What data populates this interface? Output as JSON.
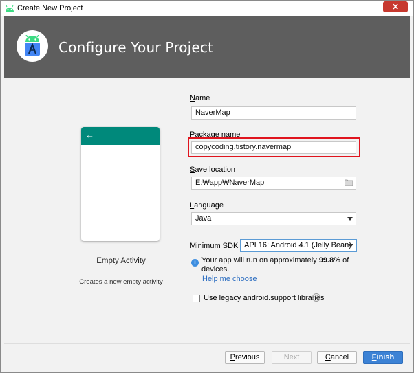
{
  "window": {
    "title": "Create New Project",
    "close_glyph": "✕"
  },
  "header": {
    "title": "Configure Your Project"
  },
  "template": {
    "back_glyph": "←",
    "name": "Empty Activity",
    "description": "Creates a new empty activity"
  },
  "form": {
    "name_label_key": "N",
    "name_label_rest": "ame",
    "name_value": "NaverMap",
    "package_label_key": "P",
    "package_label_rest": "ackage name",
    "package_value": "copycoding.tistory.navermap",
    "location_label_key": "S",
    "location_label_rest": "ave location",
    "location_value": "E:₩app₩NaverMap",
    "language_label_key": "L",
    "language_label_rest": "anguage",
    "language_value": "Java",
    "sdk_label": "Minimum SDK",
    "sdk_value": "API 16: Android 4.1 (Jelly Bean)",
    "info_prefix": "Your app will run on approximately ",
    "info_percent": "99.8%",
    "info_suffix": " of devices.",
    "help_link": "Help me choose",
    "legacy_label": "Use legacy android.support libraries",
    "legacy_checked": false
  },
  "footer": {
    "previous_key": "P",
    "previous_rest": "revious",
    "next_label": "Next",
    "cancel_key": "C",
    "cancel_rest": "ancel",
    "finish_key": "F",
    "finish_rest": "inish"
  },
  "colors": {
    "header_bg": "#5e5e5e",
    "toolbar": "#00897b",
    "highlight": "#e0141e",
    "primary": "#3c82d5"
  },
  "icons": {
    "app": "android-studio-icon",
    "logo": "android-studio-logo",
    "folder": "folder-icon",
    "info": "info-icon",
    "help": "question-icon"
  }
}
